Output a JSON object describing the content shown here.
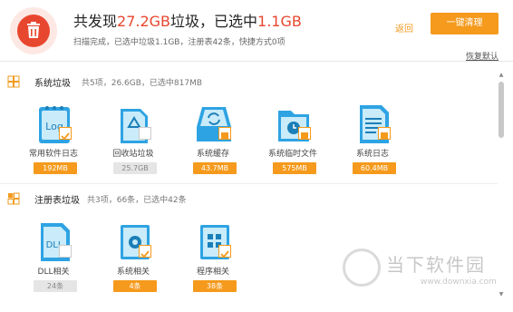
{
  "header": {
    "headline_prefix": "共发现",
    "found_size": "27.2GB",
    "headline_mid": "垃圾，已选中",
    "selected_size": "1.1GB",
    "subline": "扫描完成，已选中垃圾1.1GB，注册表42条，快捷方式0项",
    "back_label": "返回",
    "clean_label": "一键清理",
    "restore_label": "恢复默认"
  },
  "sections": [
    {
      "title": "系统垃圾",
      "meta": "共5项，26.6GB，已选中817MB",
      "items": [
        {
          "label": "常用软件日志",
          "value": "192MB",
          "checked": true,
          "icon": "log-file-icon"
        },
        {
          "label": "回收站垃圾",
          "value": "25.7GB",
          "checked": false,
          "icon": "recycle-bin-icon"
        },
        {
          "label": "系统缓存",
          "value": "43.7MB",
          "checked": true,
          "icon": "cache-refresh-icon"
        },
        {
          "label": "系统临时文件",
          "value": "575MB",
          "checked": true,
          "icon": "temp-folder-clock-icon"
        },
        {
          "label": "系统日志",
          "value": "60.4MB",
          "checked": true,
          "icon": "system-log-icon"
        }
      ]
    },
    {
      "title": "注册表垃圾",
      "meta": "共3项，66条，已选中42条",
      "items": [
        {
          "label": "DLL相关",
          "value": "24条",
          "checked": false,
          "icon": "dll-file-icon"
        },
        {
          "label": "系统相关",
          "value": "4条",
          "checked": true,
          "icon": "gear-folder-icon"
        },
        {
          "label": "程序相关",
          "value": "38条",
          "checked": true,
          "icon": "program-grid-icon"
        }
      ]
    }
  ],
  "watermark": {
    "brand": "当下软件园",
    "url": "www.downxia.com"
  },
  "colors": {
    "accent": "#f59a1c",
    "highlight": "#e8472f",
    "icon_blue": "#2ea3e3",
    "icon_light": "#c9ebfa"
  }
}
